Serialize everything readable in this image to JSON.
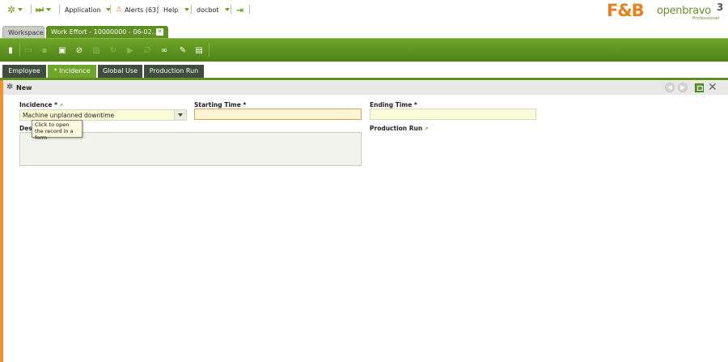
{
  "navbar": {
    "application_label": "Application",
    "alerts_label": "Alerts (63)",
    "help_label": "Help",
    "user_label": "docbot"
  },
  "brand": {
    "customer_logo_text": "F&B",
    "product_logo_text": "openbravo",
    "product_version": "3",
    "edition_label": "Professional"
  },
  "window_tabs": [
    {
      "label": "Workspace"
    },
    {
      "label": "Work Effort - 10000000 - 06-02..."
    }
  ],
  "sub_tabs": [
    {
      "label": "Employee"
    },
    {
      "label": "* Incidence"
    },
    {
      "label": "Global Use"
    },
    {
      "label": "Production Run"
    }
  ],
  "form": {
    "status_label": "New",
    "incidence_label": "Incidence *",
    "incidence_value": "Machine unplanned downtime",
    "starting_time_label": "Starting Time *",
    "starting_time_value": "",
    "ending_time_label": "Ending Time *",
    "ending_time_value": "",
    "description_label": "Des",
    "production_run_label": "Production Run",
    "tooltip_text": "Click to open the record in a form"
  },
  "colors": {
    "brand_green": "#5e8f20",
    "accent_orange": "#f0922e",
    "required_field_bg": "#fafbd7"
  },
  "icons": {
    "workspace": "star-icon",
    "quick_launch": "fast-forward-icon",
    "alerts": "warning-icon",
    "logout": "logout-icon"
  }
}
